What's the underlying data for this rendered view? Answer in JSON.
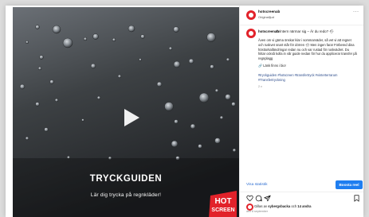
{
  "header": {
    "username": "hotscreenab",
    "audio": "Originalljud",
    "more": "···"
  },
  "caption": {
    "username": "hotscreenab",
    "headline": "#Vintern närmar sig – Är du redo? 🌧",
    "body": "Även om vi gärna önskar klar i sommarväder, så vet vi att regnet och ruskvet snart står för dörren 🌧 Men ingen fara! Förbered dina hösttorkalländringar redan nu och var rustad för ruskvädret. Du hittar också kolla in vår guide nedan för hur du applicerar transfer på regnplagg",
    "link_text": "🔗 Länk finns i bio!",
    "hashtags": "#tryckguiden #hotscreen #transfertryck #vinterterrarum #Transfertryckning",
    "time": "2 v"
  },
  "video": {
    "title": "TRYCKGUIDEN",
    "subtitle": "Lär dig trycka på regnkläder!",
    "logo_text_1": "HOT",
    "logo_text_2": "SCREEN"
  },
  "actions": {
    "insights_label": "Visa statistik",
    "boost_label": "Boosta reel",
    "likes_prefix": "Gillas av",
    "likes_user": "sybergsbacka",
    "likes_connector": "och",
    "likes_others": "14 andra",
    "date": "den 8 september"
  },
  "colors": {
    "accent": "#1f7ef0",
    "brand_red": "#e2222a",
    "link_blue": "#2f6fd1"
  }
}
